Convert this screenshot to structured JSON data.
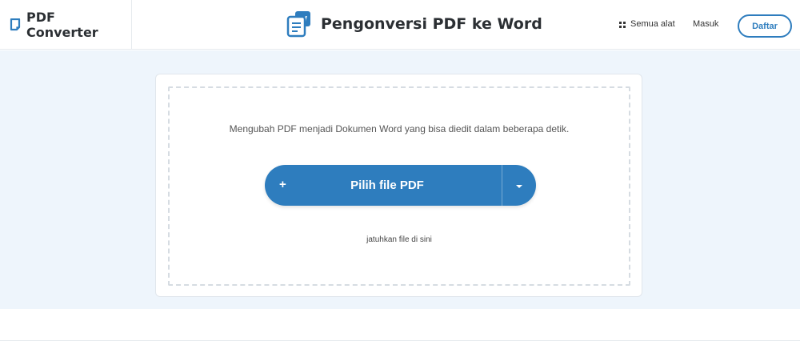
{
  "header": {
    "brand": "PDF Converter",
    "title": "Pengonversi PDF ke Word",
    "nav_tools": "Semua alat",
    "nav_login": "Masuk",
    "register": "Daftar"
  },
  "main": {
    "subtitle": "Mengubah PDF menjadi Dokumen Word yang bisa diedit dalam beberapa detik.",
    "pick_button": "Pilih file PDF",
    "plus": "+",
    "drop_hint": "jatuhkan file di sini"
  },
  "colors": {
    "accent": "#2e7dbe",
    "hero_bg": "#eef5fc"
  },
  "icons": {
    "brand": "document-tab-icon",
    "title": "pdf-to-word-icon",
    "tools": "grid-icon",
    "plus": "plus-icon",
    "dropdown": "caret-down-icon"
  }
}
